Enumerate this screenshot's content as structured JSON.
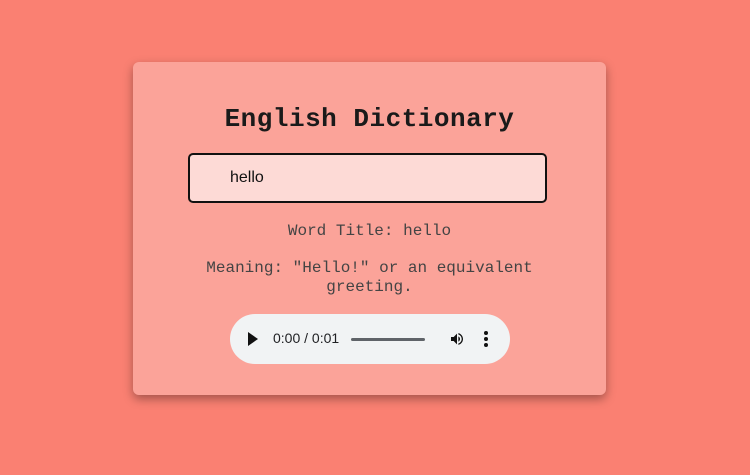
{
  "app": {
    "title": "English Dictionary"
  },
  "search": {
    "value": "hello",
    "placeholder": ""
  },
  "result": {
    "word_title": "Word Title: hello",
    "meaning": "Meaning: \"Hello!\" or an equivalent greeting."
  },
  "audio": {
    "time": "0:00 / 0:01",
    "play_icon": "play-icon",
    "volume_icon": "volume-icon",
    "menu_icon": "more-vert-icon"
  },
  "colors": {
    "background": "#fa8072"
  }
}
